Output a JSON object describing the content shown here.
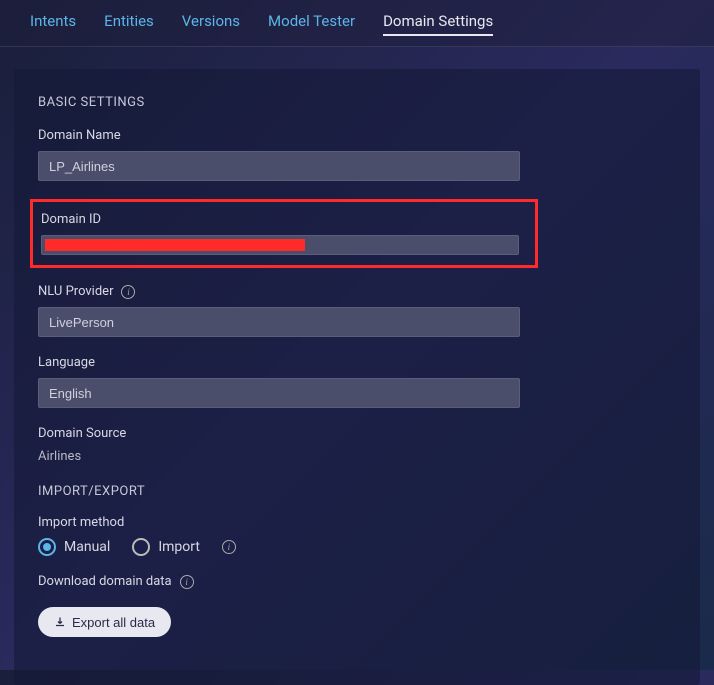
{
  "tabs": {
    "intents": "Intents",
    "entities": "Entities",
    "versions": "Versions",
    "model_tester": "Model Tester",
    "domain_settings": "Domain Settings"
  },
  "sections": {
    "basic_settings": "BASIC SETTINGS",
    "import_export": "IMPORT/EXPORT"
  },
  "fields": {
    "domain_name": {
      "label": "Domain Name",
      "value": "LP_Airlines"
    },
    "domain_id": {
      "label": "Domain ID",
      "value": ""
    },
    "nlu_provider": {
      "label": "NLU Provider",
      "value": "LivePerson"
    },
    "language": {
      "label": "Language",
      "value": "English"
    },
    "domain_source": {
      "label": "Domain Source",
      "value": "Airlines"
    },
    "import_method": {
      "label": "Import method",
      "options": {
        "manual": "Manual",
        "import": "Import"
      }
    },
    "download_domain_data": {
      "label": "Download domain data"
    }
  },
  "buttons": {
    "export_all_data": "Export all data"
  }
}
